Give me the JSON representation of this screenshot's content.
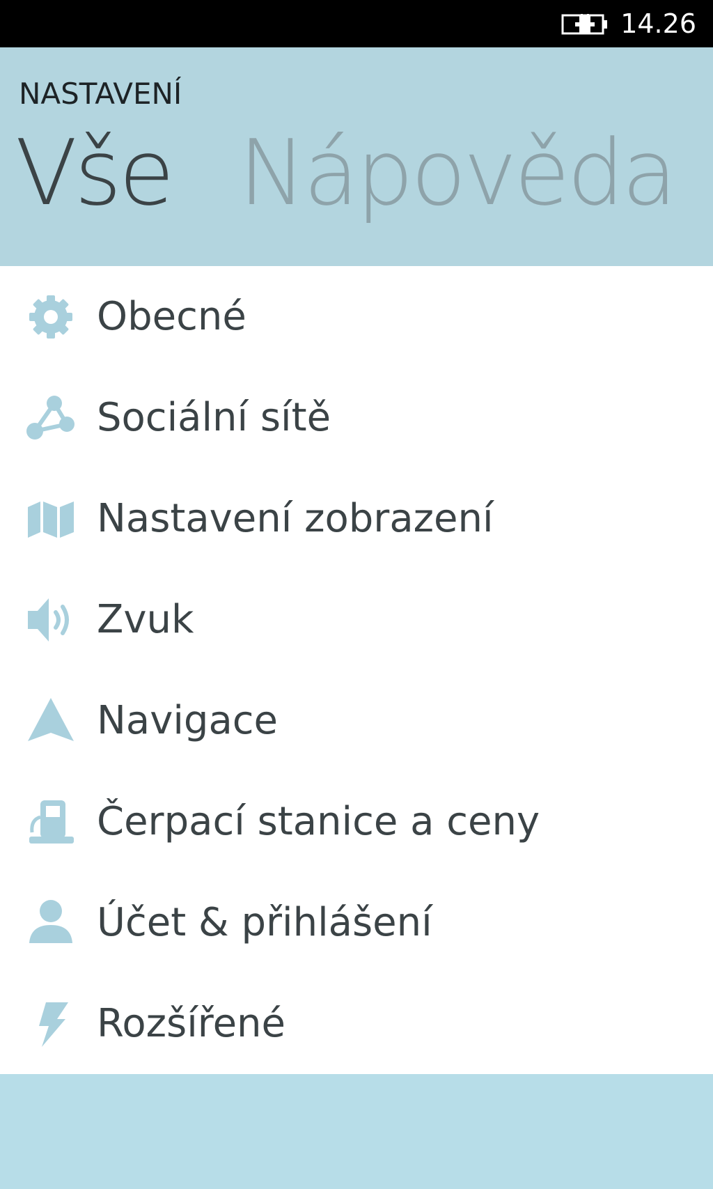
{
  "status_bar": {
    "time": "14.26",
    "battery_icon": "battery-charging-icon"
  },
  "header": {
    "app_title": "NASTAVENÍ",
    "tabs": [
      {
        "label": "Vše",
        "active": true
      },
      {
        "label": "Nápověda",
        "active": false
      }
    ]
  },
  "menu": {
    "items": [
      {
        "label": "Obecné",
        "icon": "gear-icon"
      },
      {
        "label": "Sociální sítě",
        "icon": "share-network-icon"
      },
      {
        "label": "Nastavení zobrazení",
        "icon": "map-icon"
      },
      {
        "label": "Zvuk",
        "icon": "speaker-icon"
      },
      {
        "label": "Navigace",
        "icon": "navigation-arrow-icon"
      },
      {
        "label": "Čerpací stanice a ceny",
        "icon": "fuel-pump-icon"
      },
      {
        "label": "Účet & přihlášení",
        "icon": "user-icon"
      },
      {
        "label": "Rozšířené",
        "icon": "lightning-icon"
      }
    ]
  },
  "colors": {
    "status_bar": "#000000",
    "header_bg": "#b3d5df",
    "list_bg": "#ffffff",
    "bottom_bg": "#b7dde8",
    "icon": "#a9d0dd",
    "text": "#3b4346",
    "inactive_tab": "#8ea3aa"
  }
}
